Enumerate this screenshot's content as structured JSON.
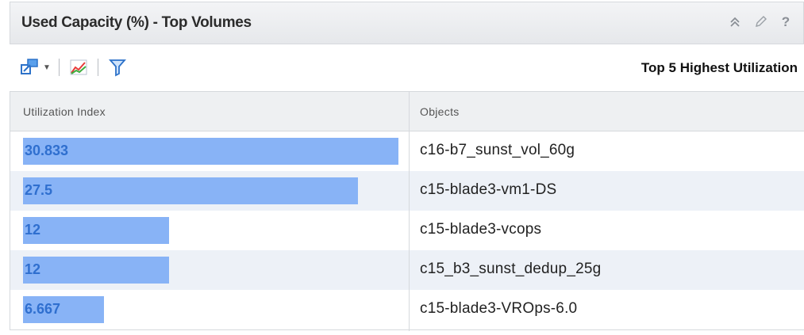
{
  "header": {
    "title": "Used Capacity (%) - Top Volumes",
    "icons": [
      "collapse-icon",
      "edit-icon",
      "help-icon"
    ],
    "help_glyph": "?"
  },
  "toolbar": {
    "right_label": "Top 5 Highest Utilization",
    "icons": [
      "object-navigate-icon",
      "trend-chart-icon",
      "filter-icon"
    ]
  },
  "table": {
    "columns": [
      "Utilization Index",
      "Objects"
    ],
    "max_value": 30.833,
    "rows": [
      {
        "value": 30.833,
        "value_label": "30.833",
        "object": "c16-b7_sunst_vol_60g"
      },
      {
        "value": 27.5,
        "value_label": "27.5",
        "object": "c15-blade3-vm1-DS"
      },
      {
        "value": 12,
        "value_label": "12",
        "object": "c15-blade3-vcops"
      },
      {
        "value": 12,
        "value_label": "12",
        "object": "c15_b3_sunst_dedup_25g"
      },
      {
        "value": 6.667,
        "value_label": "6.667",
        "object": "c15-blade3-VROps-6.0"
      }
    ]
  },
  "colors": {
    "bar_fill": "#88b3f6",
    "bar_text": "#2f6fcf",
    "row_alt": "#edf1f7"
  }
}
